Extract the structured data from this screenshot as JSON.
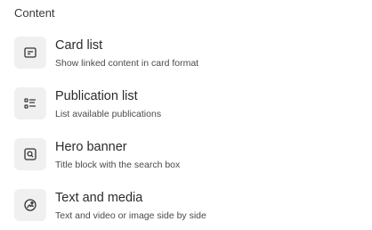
{
  "section": {
    "title": "Content"
  },
  "items": [
    {
      "title": "Card list",
      "description": "Show linked content in card format",
      "icon": "card-icon"
    },
    {
      "title": "Publication list",
      "description": "List available publications",
      "icon": "list-icon"
    },
    {
      "title": "Hero banner",
      "description": "Title block with the search box",
      "icon": "search-box-icon"
    },
    {
      "title": "Text and media",
      "description": "Text and video or image side by side",
      "icon": "media-icon"
    }
  ],
  "colors": {
    "icon_bg": "#f0f0f0",
    "text": "#2b2b2b",
    "muted": "#4a4a4a"
  }
}
